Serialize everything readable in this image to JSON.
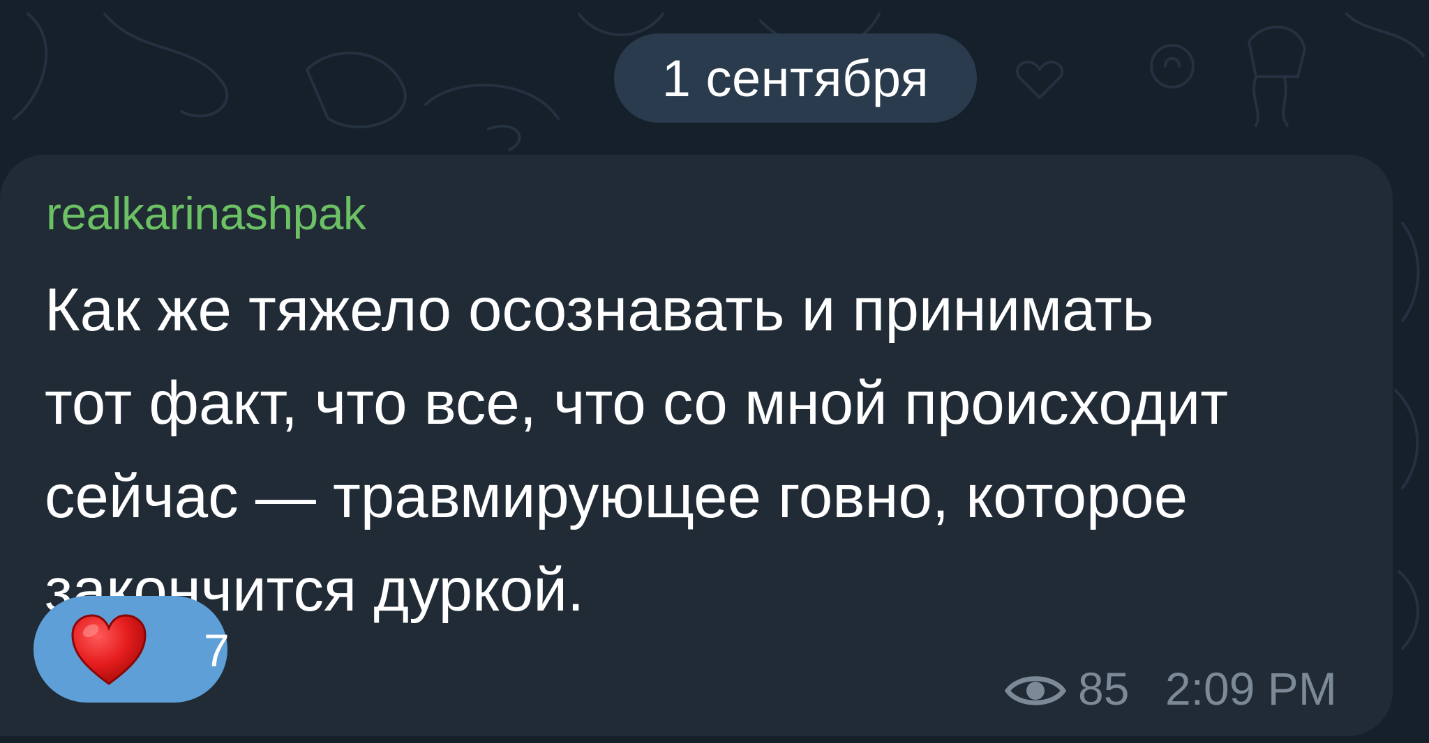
{
  "chat": {
    "date_separator": "1 сентября"
  },
  "message": {
    "sender": "realkarinashpak",
    "text_lines": [
      "Как же тяжело осознавать и принимать",
      "тот факт, что все, что со мной происходит",
      "сейчас — травмирующее говно, которое",
      "закончится дуркой."
    ],
    "reaction": {
      "emoji_icon": "red-heart-icon",
      "count": "7"
    },
    "views": "85",
    "time": "2:09 PM"
  },
  "colors": {
    "background": "#16202b",
    "bubble": "#202b36",
    "date_pill": "#2a3b4d",
    "sender_name": "#6cc164",
    "reaction_pill": "#5e9fd7",
    "meta_text": "#7c8a98"
  }
}
